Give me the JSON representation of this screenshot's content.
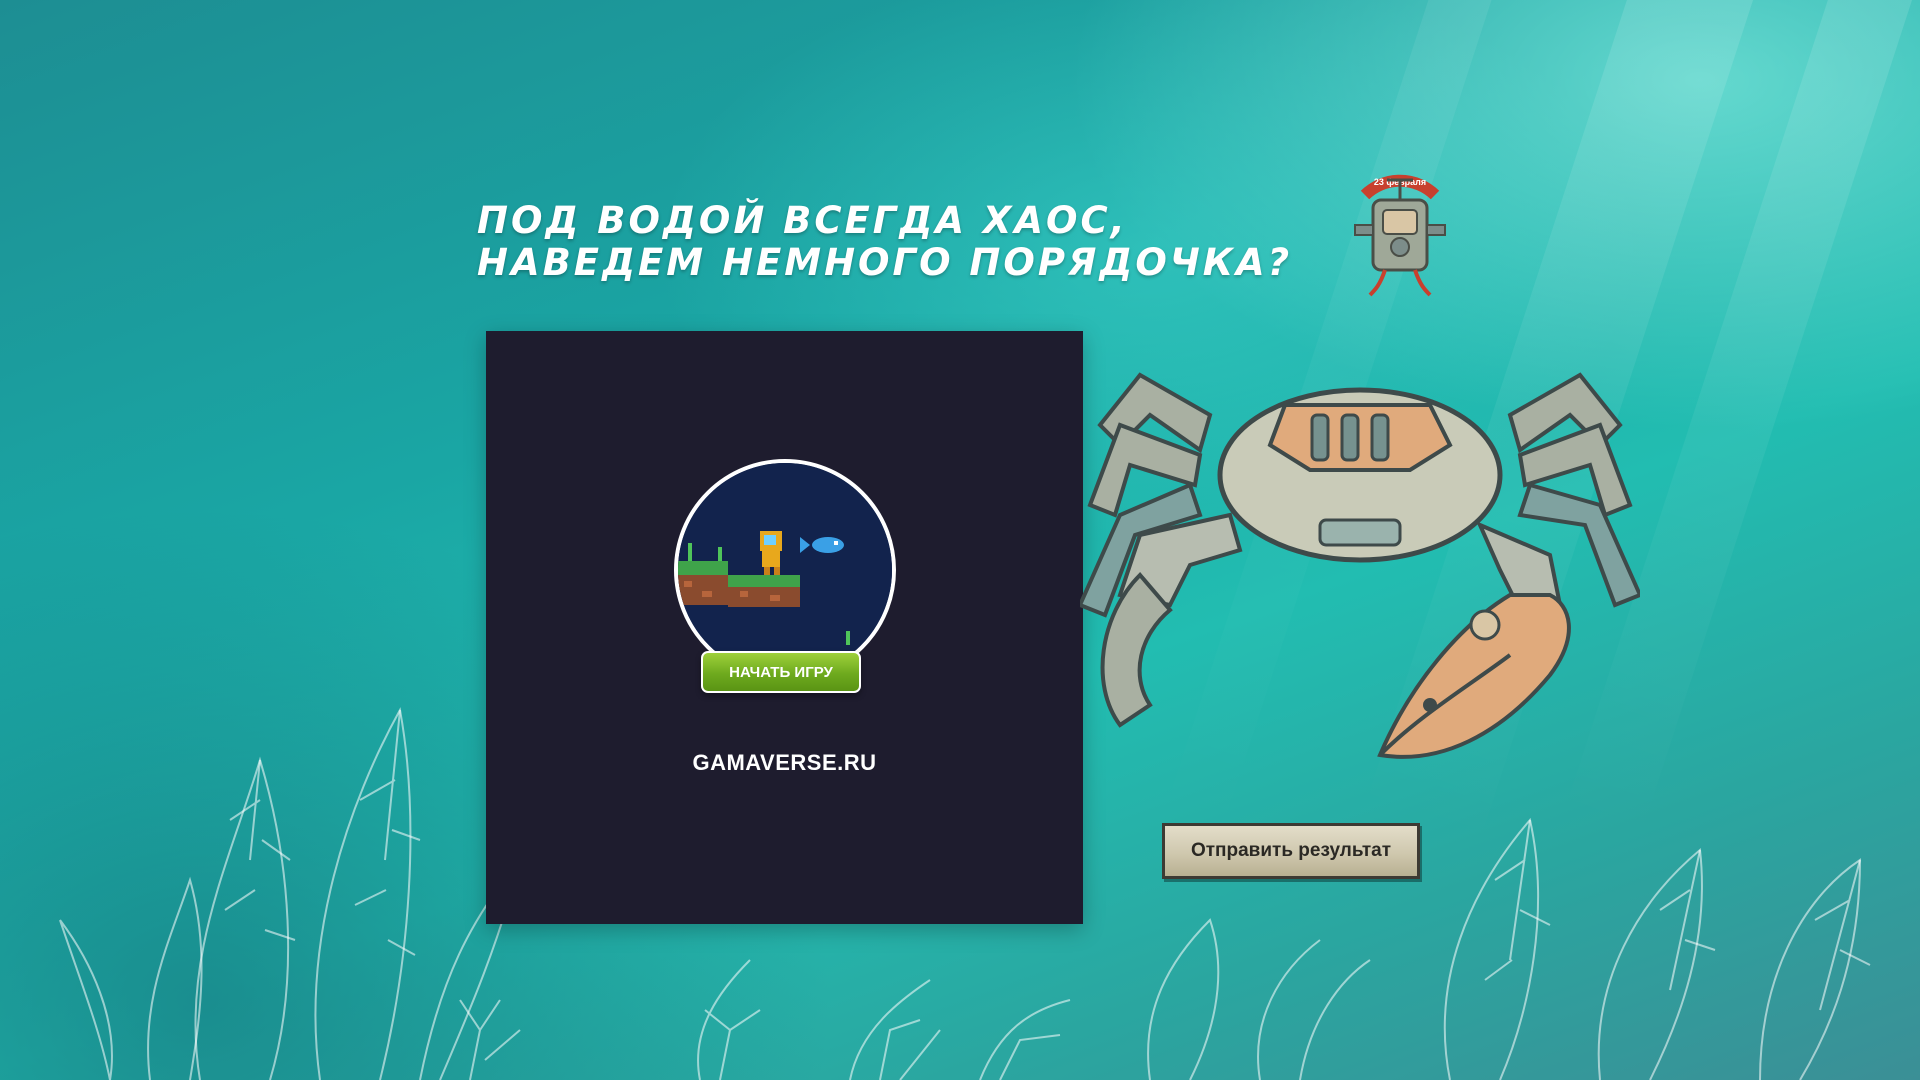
{
  "headline": {
    "line1": "ПОД ВОДОЙ ВСЕГДА ХАОС,",
    "line2": "НАВЕДЕМ НЕМНОГО ПОРЯДОЧКА?"
  },
  "game": {
    "start_label": "НАЧАТЬ ИГРУ",
    "site": "GAMAVERSE.RU"
  },
  "badge": {
    "text": "23 февраля"
  },
  "submit_label": "Отправить результат",
  "colors": {
    "background": "#1aa6a4",
    "panel": "#1e1c2e",
    "start_button": "#7cb822",
    "submit_button": "#d6cfb6"
  }
}
